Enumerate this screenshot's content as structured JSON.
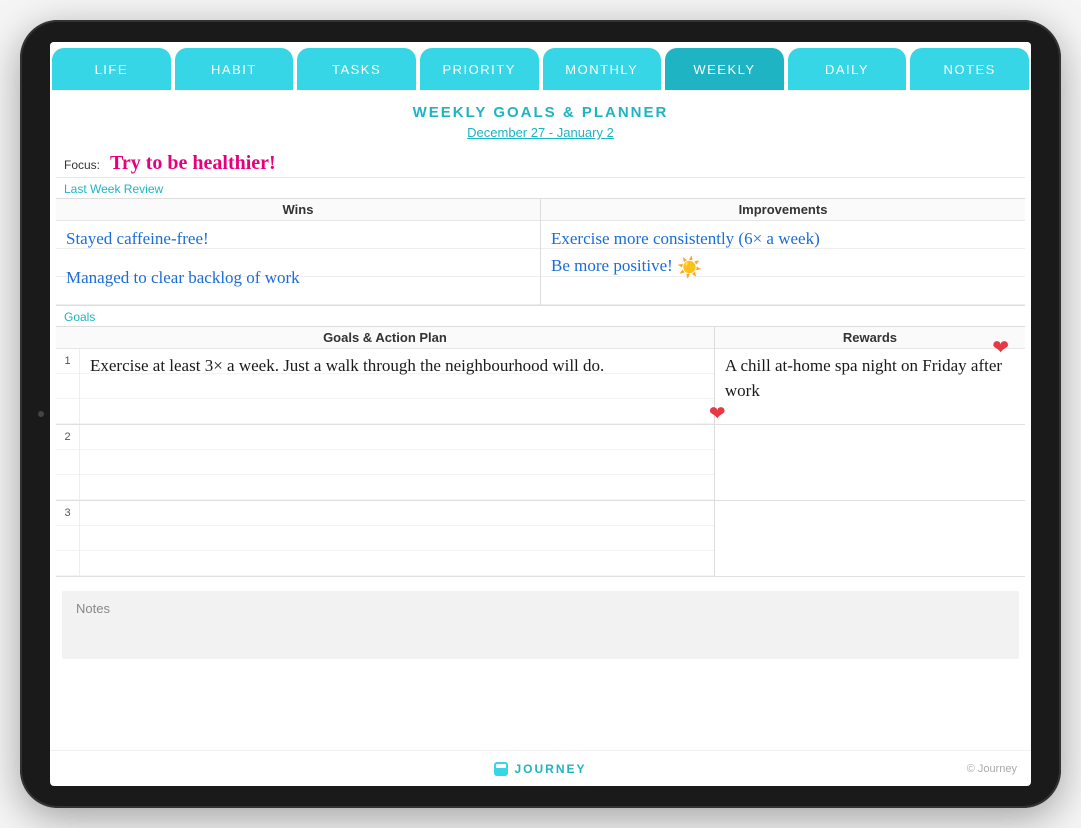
{
  "tabs": [
    "LIFE",
    "HABIT",
    "TASKS",
    "PRIORITY",
    "MONTHLY",
    "WEEKLY",
    "DAILY",
    "NOTES"
  ],
  "active_tab_index": 5,
  "header": {
    "title": "WEEKLY GOALS & PLANNER",
    "date_range": "December 27 - January 2"
  },
  "focus": {
    "label": "Focus:",
    "text": "Try to be healthier!"
  },
  "review": {
    "section_label": "Last Week Review",
    "wins_header": "Wins",
    "improvements_header": "Improvements",
    "wins_line1": "Stayed caffeine-free!",
    "wins_line2": "Managed to clear backlog of work",
    "improvements_line1": "Exercise more consistently (6× a week)",
    "improvements_line2": "Be more positive! "
  },
  "goals": {
    "section_label": "Goals",
    "plan_header": "Goals & Action Plan",
    "rewards_header": "Rewards",
    "row1": {
      "num": "1",
      "plan": "Exercise at least 3× a week. Just a walk through the neighbourhood will do.",
      "reward": "A chill at-home spa night on Friday after work"
    },
    "row2": {
      "num": "2",
      "plan": "",
      "reward": ""
    },
    "row3": {
      "num": "3",
      "plan": "",
      "reward": ""
    }
  },
  "notes": {
    "label": "Notes",
    "text": ""
  },
  "footer": {
    "brand": "JOURNEY",
    "copyright": "© Journey"
  }
}
